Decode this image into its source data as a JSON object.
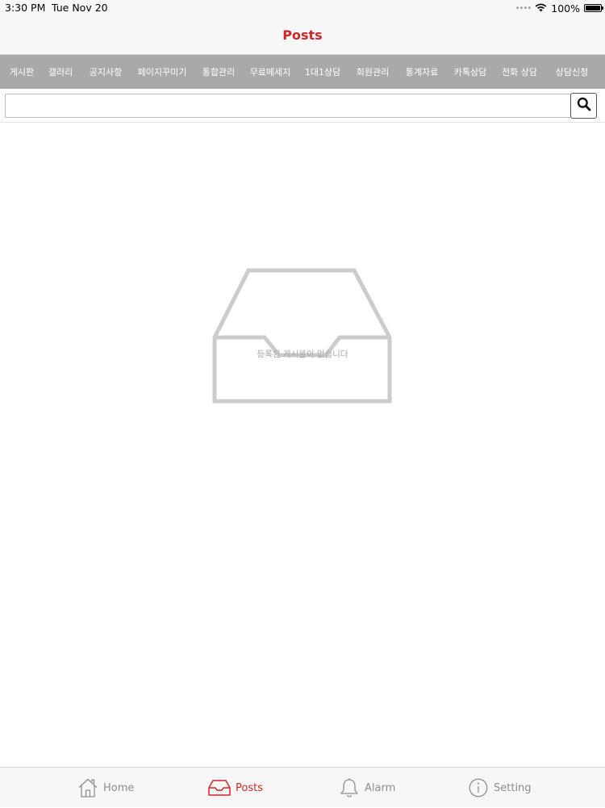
{
  "status_bar": {
    "time": "3:30 PM",
    "date": "Tue Nov 20",
    "battery": "100%",
    "signal_icon": "signal-dots-icon",
    "wifi_icon": "wifi-icon",
    "battery_icon": "battery-icon",
    "battery_level": 1.0
  },
  "nav": {
    "title": "Posts",
    "title_color": "#d0262a"
  },
  "menu": {
    "background": "#a9a9a9",
    "items": [
      {
        "label": "게시판"
      },
      {
        "label": "갤러리"
      },
      {
        "label": "공지사항"
      },
      {
        "label": "페이지꾸미기"
      },
      {
        "label": "통합관리"
      },
      {
        "label": "무료메세지"
      },
      {
        "label": "1대1상담"
      },
      {
        "label": "회원관리"
      },
      {
        "label": "통계자료"
      },
      {
        "label": "카톡상담"
      },
      {
        "label": "전화 상담"
      },
      {
        "label": "상담신청"
      }
    ]
  },
  "search": {
    "value": "",
    "placeholder": "",
    "button_icon": "search-icon"
  },
  "empty_state": {
    "icon": "inbox-tray-icon",
    "message": "등록된 게시물이 없습니다"
  },
  "tabs": [
    {
      "label": "Home",
      "icon": "home-icon",
      "active": false
    },
    {
      "label": "Posts",
      "icon": "inbox-icon",
      "active": true
    },
    {
      "label": "Alarm",
      "icon": "bell-icon",
      "active": false
    },
    {
      "label": "Setting",
      "icon": "info-icon",
      "active": false
    }
  ],
  "colors": {
    "accent": "#d0262a",
    "inactive": "#8e8e8e"
  }
}
